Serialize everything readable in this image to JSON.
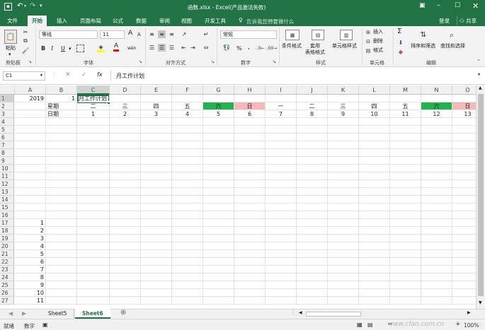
{
  "window": {
    "title": "函数.xlsx - Excel(产品激活失败)",
    "sign_in": "登录",
    "share": "共享"
  },
  "tabs": [
    "文件",
    "开始",
    "插入",
    "页面布局",
    "公式",
    "数据",
    "审阅",
    "视图",
    "开发工具"
  ],
  "active_tab": "开始",
  "tell_me": "告诉我您想要做什么",
  "ribbon": {
    "clipboard": {
      "paste": "粘贴",
      "label": "剪贴板"
    },
    "font": {
      "name": "等线",
      "size": "11",
      "label": "字体",
      "bold": "B",
      "italic": "I",
      "underline": "U",
      "grow": "A",
      "shrink": "A",
      "color_glyph": "A",
      "phonetic": "wén"
    },
    "alignment": {
      "label": "对齐方式"
    },
    "number": {
      "format": "常规",
      "label": "数字",
      "percent": "%",
      "comma": ","
    },
    "styles": {
      "conditional": "条件格式",
      "table": "套用\n表格格式",
      "cell_styles": "单元格样式",
      "label": "样式"
    },
    "cells": {
      "insert": "插入",
      "delete": "删除",
      "format": "格式",
      "label": "单元格"
    },
    "editing": {
      "sort": "排序和筛选",
      "find": "查找和选择",
      "label": "编辑",
      "sigma": "Σ"
    }
  },
  "formula_bar": {
    "name_box": "C1",
    "fx": "fx",
    "formula": "月工作计划"
  },
  "columns": [
    "A",
    "B",
    "C",
    "D",
    "E",
    "F",
    "G",
    "H",
    "I",
    "J",
    "K",
    "L",
    "M",
    "N",
    "O"
  ],
  "rows": [
    "1",
    "2",
    "3",
    "4",
    "5",
    "6",
    "7",
    "8",
    "9",
    "10",
    "11",
    "12",
    "13",
    "14",
    "15",
    "16",
    "17",
    "18",
    "19",
    "20",
    "21",
    "22",
    "23",
    "24",
    "25",
    "26",
    "27"
  ],
  "cells": {
    "A1": "2019",
    "B1": "1",
    "C1": "月工作计划",
    "B2": "星期",
    "C2": "二",
    "D2": "三",
    "E2": "四",
    "F2": "五",
    "G2": "六",
    "H2": "日",
    "I2": "一",
    "J2": "二",
    "K2": "三",
    "L2": "四",
    "M2": "五",
    "N2": "六",
    "O2": "日",
    "B3": "日期",
    "C3": "1",
    "D3": "2",
    "E3": "3",
    "F3": "4",
    "G3": "5",
    "H3": "6",
    "I3": "7",
    "J3": "8",
    "K3": "9",
    "L3": "10",
    "M3": "11",
    "N3": "12",
    "O3": "13",
    "A17": "1",
    "A18": "2",
    "A19": "3",
    "A20": "4",
    "A21": "5",
    "A22": "6",
    "A23": "7",
    "A24": "8",
    "A25": "9",
    "A26": "10",
    "A27": "11"
  },
  "colors": {
    "brand": "#217346",
    "saturday": "#22b14c",
    "sunday": "#f4b8bd"
  },
  "sheets": [
    "Sheet5",
    "Sheet6"
  ],
  "active_sheet": "Sheet6",
  "status": {
    "ready": "就绪",
    "numlock": "数字",
    "zoom": "100%"
  },
  "watermark": "www.cfan.com.cn"
}
